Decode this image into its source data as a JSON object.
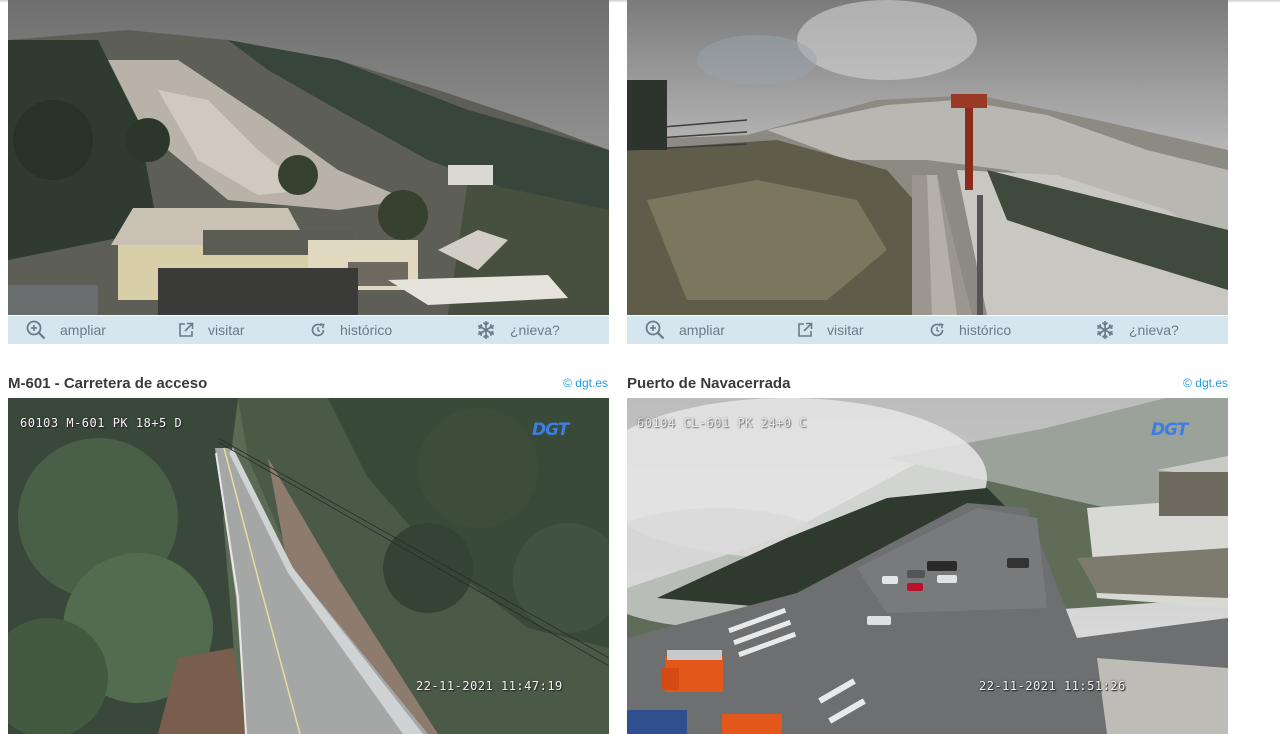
{
  "cards": [
    {
      "toolbar": {
        "zoom": "ampliar",
        "visit": "visitar",
        "history": "histórico",
        "snow": "¿nieva?"
      }
    },
    {
      "toolbar": {
        "zoom": "ampliar",
        "visit": "visitar",
        "history": "histórico",
        "snow": "¿nieva?"
      }
    },
    {
      "title": "M-601 - Carretera de acceso",
      "source": "© dgt.es",
      "overlay_id": "60103 M-601 PK 18+5 D",
      "logo": "DGT",
      "timestamp": "22-11-2021 11:47:19"
    },
    {
      "title": "Puerto de Navacerrada",
      "source": "© dgt.es",
      "overlay_id": "60104 CL-601 PK 24+0 C",
      "logo": "DGT",
      "timestamp": "22-11-2021 11:51:26"
    }
  ],
  "colors": {
    "toolbar_bg": "#d6e6ee",
    "link": "#1f9be0",
    "title": "#3a3a3a"
  }
}
